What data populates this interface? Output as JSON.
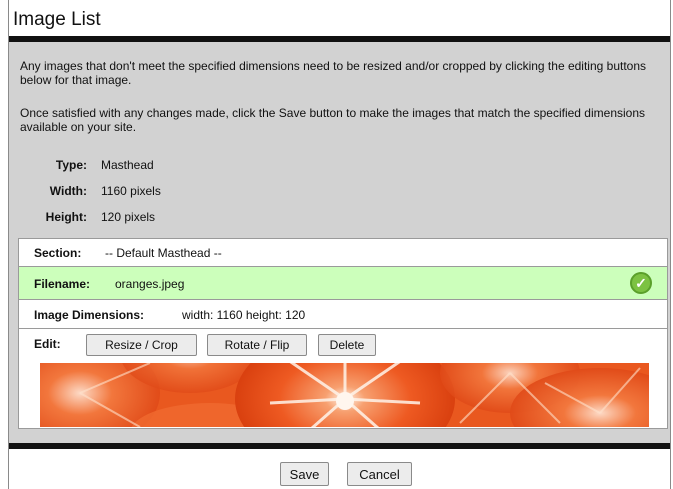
{
  "window": {
    "title": "Image List"
  },
  "intro": {
    "paragraph1": "Any images that don't meet the specified dimensions need to be resized and/or cropped by clicking the editing buttons below for that image.",
    "paragraph2": "Once satisfied with any changes made, click the Save button to make the images that match the specified dimensions available on your site."
  },
  "specs": {
    "type_label": "Type:",
    "type_value": "Masthead",
    "width_label": "Width:",
    "width_value": "1160 pixels",
    "height_label": "Height:",
    "height_value": "120 pixels"
  },
  "image_entry": {
    "section_label": "Section:",
    "section_value": "-- Default Masthead --",
    "filename_label": "Filename:",
    "filename_value": "oranges.jpeg",
    "dimensions_label": "Image Dimensions:",
    "dimensions_value": "width: 1160 height: 120",
    "edit_label": "Edit:",
    "buttons": {
      "resize_crop": "Resize / Crop",
      "rotate_flip": "Rotate / Flip",
      "delete": "Delete"
    },
    "status_icon": "check-circle-icon",
    "status_color": "#7cc242",
    "row_highlight_color": "#ccffbb"
  },
  "footer": {
    "save_label": "Save",
    "cancel_label": "Cancel"
  }
}
